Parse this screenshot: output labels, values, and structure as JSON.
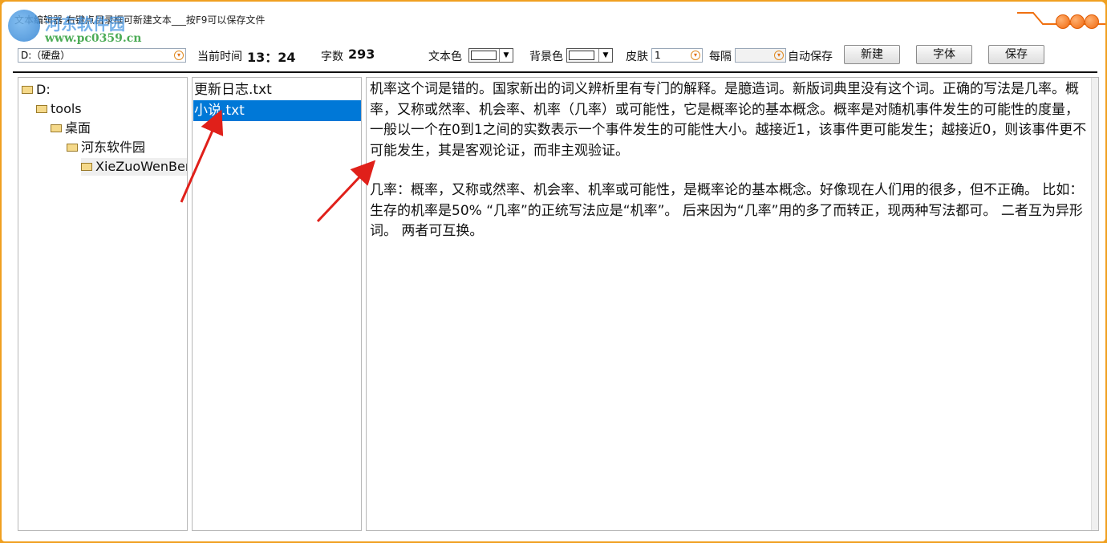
{
  "window": {
    "title": "文本编辑器    右键点目录框可新建文本___按F9可以保存文件"
  },
  "watermark": {
    "name": "河东软件园",
    "url": "www.pc0359.cn"
  },
  "toolbar": {
    "drive_value": "D:（硬盘）",
    "time_label": "当前时间",
    "time_value": "13：24",
    "count_label": "字数",
    "count_value": "293",
    "text_color_label": "文本色",
    "bg_color_label": "背景色",
    "skin_label": "皮肤",
    "skin_value": "1",
    "interval_label": "每隔",
    "interval_value": "",
    "autosave_label": "自动保存",
    "new_label": "新建",
    "font_label": "字体",
    "save_label": "保存"
  },
  "tree": {
    "items": [
      {
        "label": "D:",
        "depth": 0
      },
      {
        "label": "tools",
        "depth": 1
      },
      {
        "label": "桌面",
        "depth": 2
      },
      {
        "label": "河东软件园",
        "depth": 3
      },
      {
        "label": "XieZuoWenBen",
        "depth": 4
      }
    ]
  },
  "files": {
    "items": [
      {
        "label": "更新日志.txt",
        "selected": false
      },
      {
        "label": "小说.txt",
        "selected": true
      }
    ]
  },
  "editor": {
    "paragraphs": [
      "机率这个词是错的。国家新出的词义辨析里有专门的解释。是臆造词。新版词典里没有这个词。正确的写法是几率。概率，又称或然率、机会率、机率（几率）或可能性，它是概率论的基本概念。概率是对随机事件发生的可能性的度量，一般以一个在0到1之间的实数表示一个事件发生的可能性大小。越接近1，该事件更可能发生；越接近0，则该事件更不可能发生，其是客观论证，而非主观验证。",
      "几率：概率，又称或然率、机会率、机率或可能性，是概率论的基本概念。好像现在人们用的很多，但不正确。 比如： 生存的机率是50% “几率”的正统写法应是“机率”。 后来因为“几率”用的多了而转正，现两种写法都可。 二者互为异形词。 两者可互换。"
    ]
  },
  "colors": {
    "frame": "#f0a020",
    "selection": "#0078d7",
    "annotation_arrow": "#e0201a"
  }
}
